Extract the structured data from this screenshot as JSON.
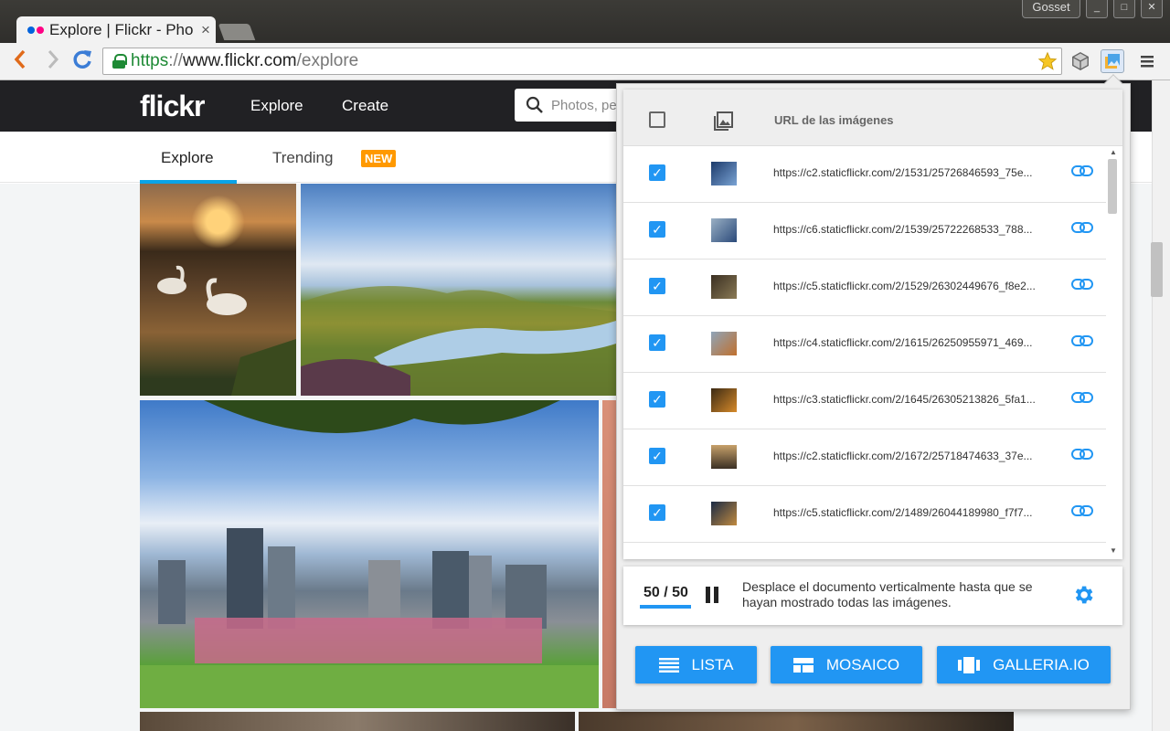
{
  "window": {
    "user": "Gosset",
    "controls": [
      "_",
      "□",
      "✕"
    ]
  },
  "tab": {
    "title": "Explore | Flickr - Pho",
    "close": "×",
    "favicon_colors": [
      "#0063dc",
      "#ff0084"
    ]
  },
  "address": {
    "scheme": "https",
    "sep": "://",
    "host": "www.flickr.com",
    "path": "/explore"
  },
  "flickr": {
    "logo": "flickr",
    "nav": [
      "Explore",
      "Create"
    ],
    "search_placeholder": "Photos, pe",
    "subnav": {
      "explore": "Explore",
      "trending": "Trending",
      "new_badge": "NEW"
    }
  },
  "popup": {
    "header_label": "URL de las imágenes",
    "rows": [
      {
        "url": "https://c2.staticflickr.com/2/1531/25726846593_75e...",
        "checked": true,
        "thumb": [
          "#1c3a6a",
          "#7aa3d4"
        ]
      },
      {
        "url": "https://c6.staticflickr.com/2/1539/25722268533_788...",
        "checked": true,
        "thumb": [
          "#9ab0c4",
          "#2b4a7a"
        ]
      },
      {
        "url": "https://c5.staticflickr.com/2/1529/26302449676_f8e2...",
        "checked": true,
        "thumb": [
          "#3a2f22",
          "#8a7a55"
        ]
      },
      {
        "url": "https://c4.staticflickr.com/2/1615/26250955971_469...",
        "checked": true,
        "thumb": [
          "#8fa4b8",
          "#c0702e"
        ]
      },
      {
        "url": "https://c3.staticflickr.com/2/1645/26305213826_5fa1...",
        "checked": true,
        "thumb": [
          "#3b2a14",
          "#d68a2a"
        ]
      },
      {
        "url": "https://c2.staticflickr.com/2/1672/25718474633_37e...",
        "checked": true,
        "thumb": [
          "#c7a16a",
          "#3b3024"
        ]
      },
      {
        "url": "https://c5.staticflickr.com/2/1489/26044189980_f7f7...",
        "checked": true,
        "thumb": [
          "#1a2a44",
          "#c08a40"
        ]
      }
    ],
    "status": {
      "count": "50 / 50",
      "progress": 1.0,
      "message": "Desplace el documento verticalmente hasta que se hayan mostrado todas las imágenes."
    },
    "buttons": {
      "lista": "LISTA",
      "mosaico": "MOSAICO",
      "galleria": "GALLERIA.IO"
    }
  },
  "colors": {
    "accent": "#2196f3",
    "flickr_blue": "#0aa4e8",
    "badge": "#ff9900"
  }
}
